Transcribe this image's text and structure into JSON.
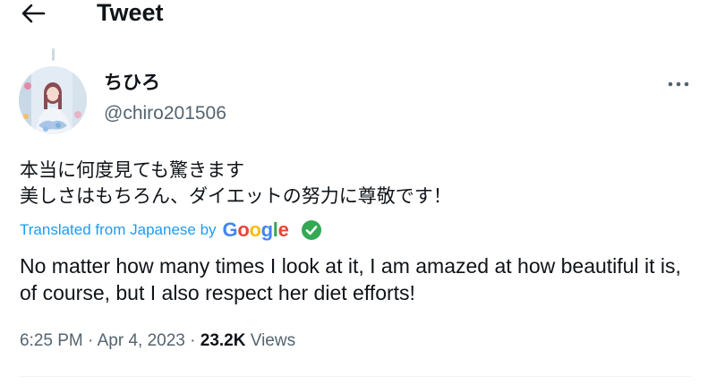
{
  "header": {
    "title": "Tweet"
  },
  "tweet": {
    "display_name": "ちひろ",
    "handle": "@chiro201506",
    "text_original": "本当に何度見ても驚きます\n美しさはもちろん、ダイエットの努力に尊敬です！",
    "translation_label": "Translated from Japanese by",
    "translation_provider": "Google",
    "text_translated": "No matter how many times I look at it, I am amazed at how beautiful it is, of course, but I also respect her diet efforts!",
    "time": "6:25 PM",
    "date": "Apr 4, 2023",
    "views_count": "23.2K",
    "views_label": "Views"
  },
  "icons": {
    "back": "arrow-left-icon",
    "more": "more-horizontal-icon",
    "verified": "verified-check-icon"
  },
  "colors": {
    "accent": "#1d9bf0",
    "secondary_text": "#536471",
    "primary_text": "#0f1419",
    "verified_green": "#34a853"
  }
}
